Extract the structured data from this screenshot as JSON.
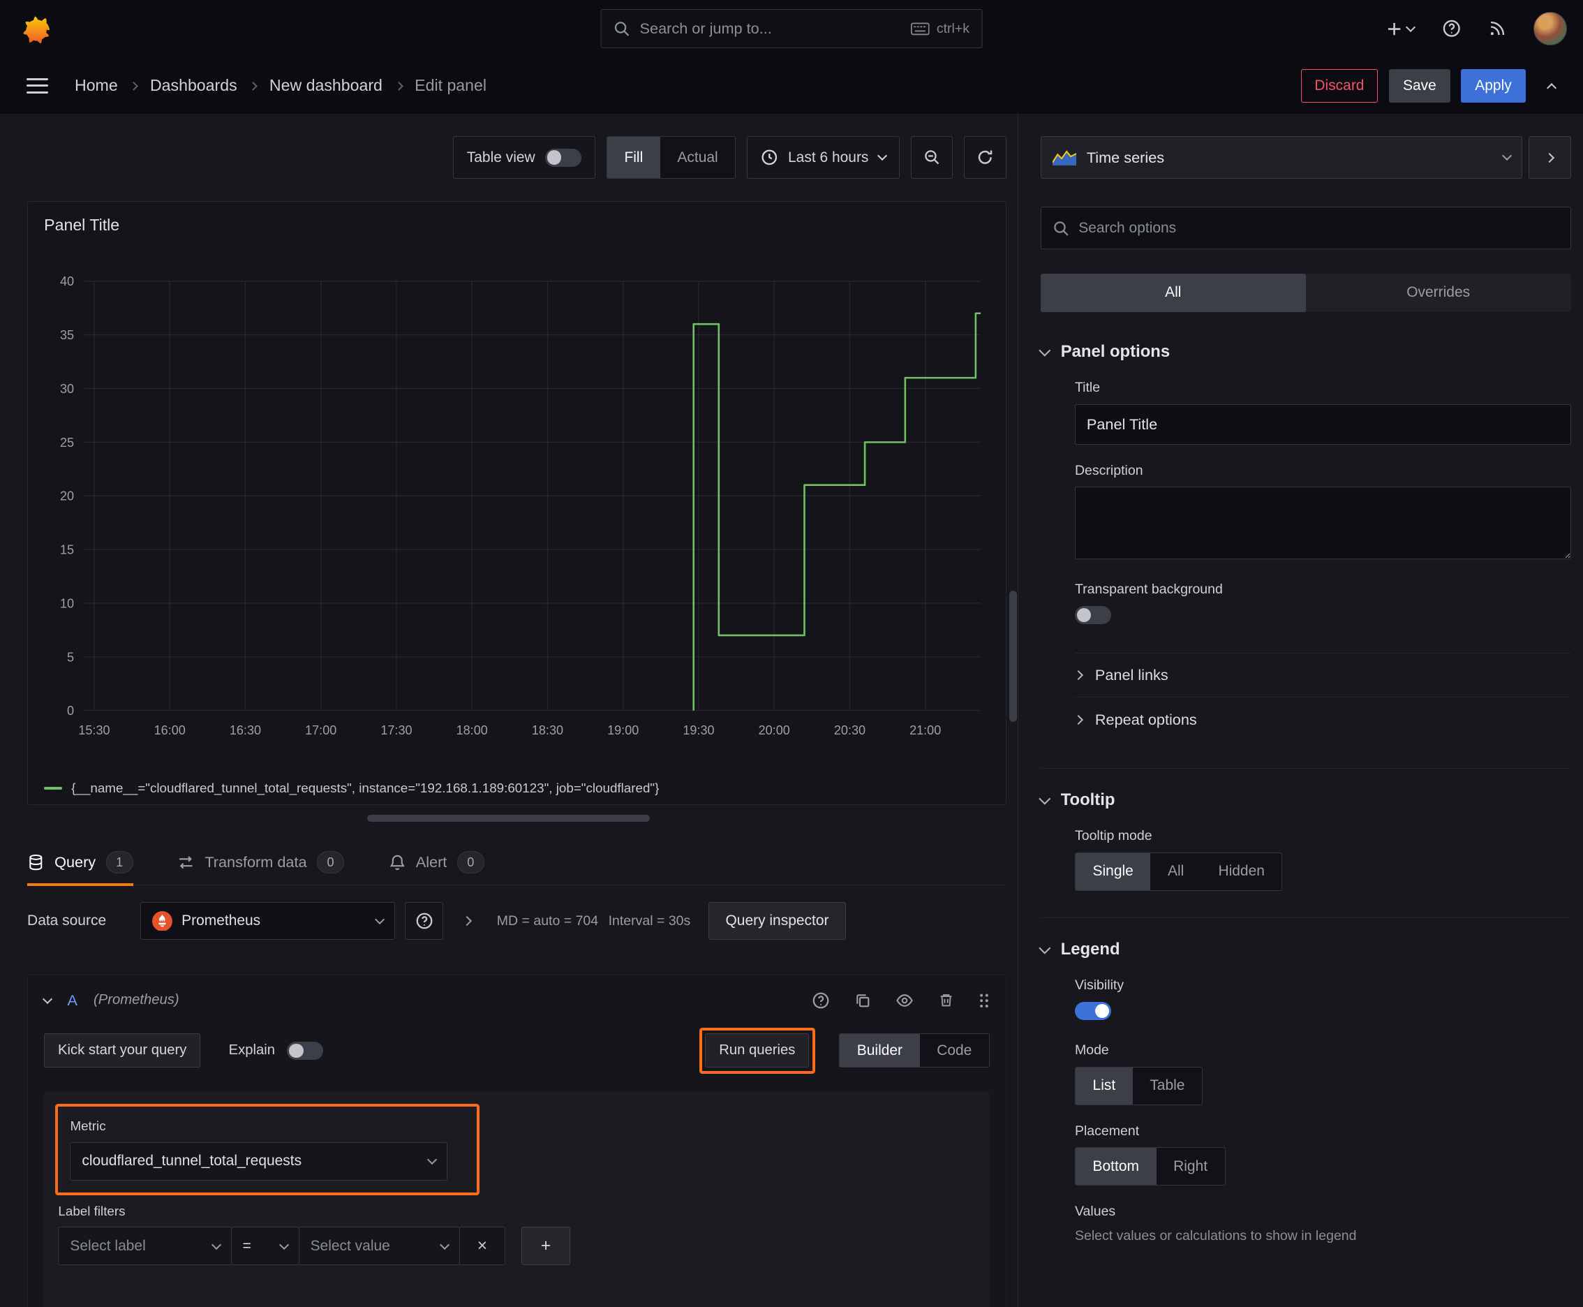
{
  "colors": {
    "accent_blue": "#3d71d9",
    "series_green": "#73bf69",
    "highlight_orange": "#ff6b18",
    "tab_orange": "#ff780a",
    "danger_red": "#f2516c"
  },
  "topbar": {
    "search_placeholder": "Search or jump to...",
    "search_shortcut": "ctrl+k"
  },
  "breadcrumb": {
    "items": [
      "Home",
      "Dashboards",
      "New dashboard",
      "Edit panel"
    ]
  },
  "actions": {
    "discard": "Discard",
    "save": "Save",
    "apply": "Apply"
  },
  "toolbar": {
    "table_view": "Table view",
    "fill": "Fill",
    "actual": "Actual",
    "time_range": "Last 6 hours"
  },
  "panel": {
    "title": "Panel Title",
    "legend": "{__name__=\"cloudflared_tunnel_total_requests\", instance=\"192.168.1.189:60123\", job=\"cloudflared\"}"
  },
  "chart_data": {
    "type": "line",
    "title": "Panel Title",
    "x_ticks": [
      "15:30",
      "16:00",
      "16:30",
      "17:00",
      "17:30",
      "18:00",
      "18:30",
      "19:00",
      "19:30",
      "20:00",
      "20:30",
      "21:00"
    ],
    "y_ticks": [
      0,
      5,
      10,
      15,
      20,
      25,
      30,
      35,
      40
    ],
    "ylim": [
      0,
      40
    ],
    "x_range": [
      "15:26",
      "21:22"
    ],
    "grid": true,
    "legend_position": "bottom",
    "series": [
      {
        "name": "{__name__=\"cloudflared_tunnel_total_requests\", instance=\"192.168.1.189:60123\", job=\"cloudflared\"}",
        "color": "#73bf69",
        "points_time_value": [
          [
            "19:28",
            0
          ],
          [
            "19:28",
            36
          ],
          [
            "19:38",
            36
          ],
          [
            "19:38",
            7
          ],
          [
            "20:12",
            7
          ],
          [
            "20:12",
            21
          ],
          [
            "20:36",
            21
          ],
          [
            "20:36",
            25
          ],
          [
            "20:52",
            25
          ],
          [
            "20:52",
            31
          ],
          [
            "21:20",
            31
          ],
          [
            "21:20",
            37
          ],
          [
            "21:22",
            37
          ]
        ]
      }
    ]
  },
  "tabs": {
    "query": {
      "label": "Query",
      "count": "1"
    },
    "transform": {
      "label": "Transform data",
      "count": "0"
    },
    "alert": {
      "label": "Alert",
      "count": "0"
    }
  },
  "datasource": {
    "label": "Data source",
    "name": "Prometheus",
    "options_summary": "MD = auto = 704",
    "interval": "Interval = 30s",
    "inspector": "Query inspector"
  },
  "query": {
    "ref_id": "A",
    "ds_hint": "(Prometheus)",
    "kickstart": "Kick start your query",
    "explain": "Explain",
    "run": "Run queries",
    "builder": "Builder",
    "code": "Code",
    "metric_label": "Metric",
    "metric_value": "cloudflared_tunnel_total_requests",
    "label_filters": "Label filters",
    "select_label": "Select label",
    "operator": "=",
    "select_value": "Select value"
  },
  "sidebar": {
    "viz_name": "Time series",
    "search_placeholder": "Search options",
    "tab_all": "All",
    "tab_overrides": "Overrides",
    "panel_options": {
      "header": "Panel options",
      "title_label": "Title",
      "title_value": "Panel Title",
      "description_label": "Description",
      "transparent_label": "Transparent background",
      "links": "Panel links",
      "repeat": "Repeat options"
    },
    "tooltip": {
      "header": "Tooltip",
      "mode_label": "Tooltip mode",
      "options": [
        "Single",
        "All",
        "Hidden"
      ],
      "selected": "Single"
    },
    "legend": {
      "header": "Legend",
      "visibility_label": "Visibility",
      "mode_label": "Mode",
      "mode_options": [
        "List",
        "Table"
      ],
      "mode_selected": "List",
      "placement_label": "Placement",
      "placement_options": [
        "Bottom",
        "Right"
      ],
      "placement_selected": "Bottom",
      "values_label": "Values",
      "values_hint": "Select values or calculations to show in legend"
    }
  }
}
